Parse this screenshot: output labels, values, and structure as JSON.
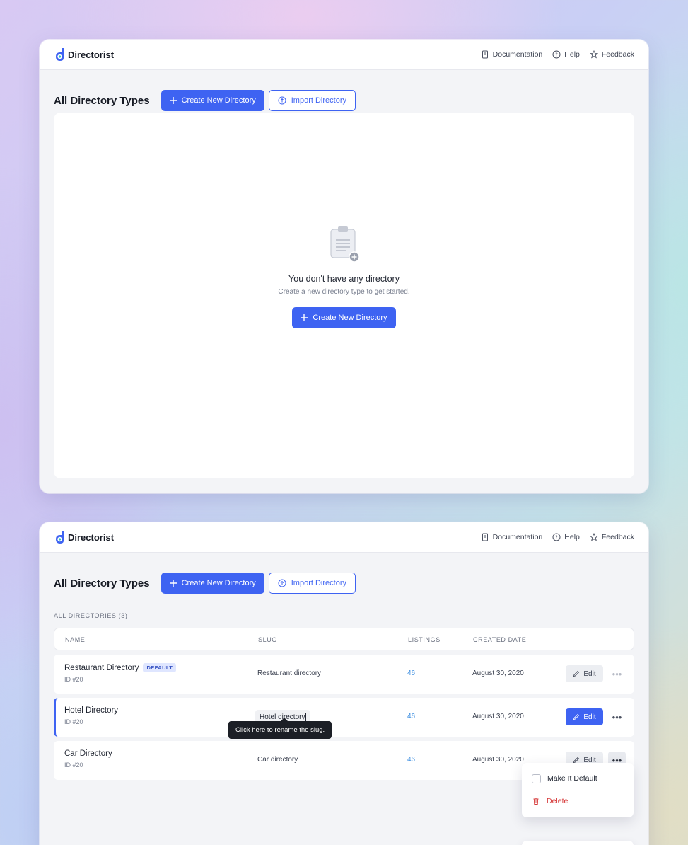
{
  "brand": {
    "name": "Directorist"
  },
  "topbar": {
    "documentation": "Documentation",
    "help": "Help",
    "feedback": "Feedback"
  },
  "header": {
    "title": "All Directory Types",
    "create_button": "Create New Directory",
    "import_button": "Import Directory"
  },
  "empty_state": {
    "title": "You don't have any directory",
    "subtitle": "Create a new directory type to get started.",
    "button": "Create New Directory"
  },
  "list": {
    "section_label": "ALL DIRECTORIES (3)",
    "columns": {
      "name": "NAME",
      "slug": "SLUG",
      "listings": "LISTINGS",
      "created": "CREATED DATE"
    },
    "rows": [
      {
        "name": "Restaurant Directory",
        "badge": "DEFAULT",
        "id": "ID #20",
        "slug": "Restaurant directory",
        "listings": "46",
        "created": "August 30, 2020",
        "edit": "Edit"
      },
      {
        "name": "Hotel Directory",
        "id": "ID #20",
        "slug": "Hotel directory",
        "listings": "46",
        "created": "August 30, 2020",
        "edit": "Edit"
      },
      {
        "name": "Car Directory",
        "id": "ID #20",
        "slug": "Car directory",
        "listings": "46",
        "created": "August 30, 2020",
        "edit": "Edit"
      }
    ],
    "more_glyph": "•••",
    "tooltip": "Click here to rename the slug.",
    "menu": {
      "make_default": "Make It Default",
      "delete": "Delete"
    }
  },
  "colors": {
    "primary": "#3e63f2",
    "danger": "#d63a3a",
    "link": "#3a8de0"
  }
}
